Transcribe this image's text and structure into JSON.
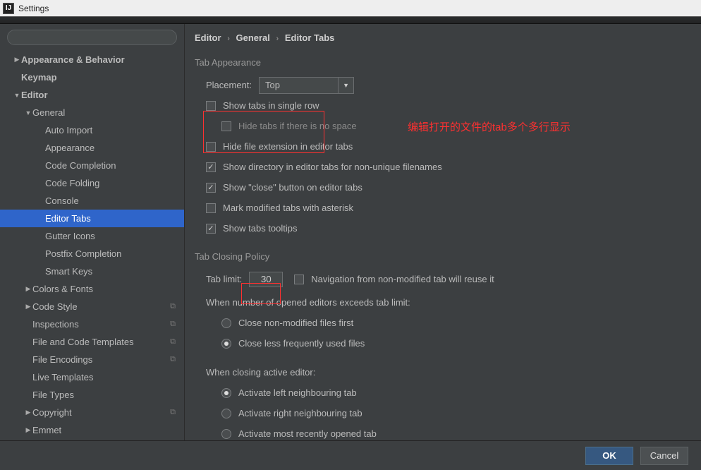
{
  "window": {
    "title": "Settings"
  },
  "sidebar": {
    "search_placeholder": "",
    "items": [
      {
        "label": "Appearance & Behavior",
        "depth": 0,
        "arrow": "right",
        "bold": true
      },
      {
        "label": "Keymap",
        "depth": 0,
        "bold": true
      },
      {
        "label": "Editor",
        "depth": 0,
        "arrow": "down",
        "bold": true
      },
      {
        "label": "General",
        "depth": 1,
        "arrow": "down"
      },
      {
        "label": "Auto Import",
        "depth": 2
      },
      {
        "label": "Appearance",
        "depth": 2
      },
      {
        "label": "Code Completion",
        "depth": 2
      },
      {
        "label": "Code Folding",
        "depth": 2
      },
      {
        "label": "Console",
        "depth": 2
      },
      {
        "label": "Editor Tabs",
        "depth": 2,
        "selected": true
      },
      {
        "label": "Gutter Icons",
        "depth": 2
      },
      {
        "label": "Postfix Completion",
        "depth": 2
      },
      {
        "label": "Smart Keys",
        "depth": 2
      },
      {
        "label": "Colors & Fonts",
        "depth": 1,
        "arrow": "right"
      },
      {
        "label": "Code Style",
        "depth": 1,
        "arrow": "right",
        "badge": true
      },
      {
        "label": "Inspections",
        "depth": 1,
        "badge": true
      },
      {
        "label": "File and Code Templates",
        "depth": 1,
        "badge": true
      },
      {
        "label": "File Encodings",
        "depth": 1,
        "badge": true
      },
      {
        "label": "Live Templates",
        "depth": 1
      },
      {
        "label": "File Types",
        "depth": 1
      },
      {
        "label": "Copyright",
        "depth": 1,
        "arrow": "right",
        "badge": true
      },
      {
        "label": "Emmet",
        "depth": 1,
        "arrow": "right"
      }
    ]
  },
  "breadcrumb": {
    "a": "Editor",
    "b": "General",
    "c": "Editor Tabs"
  },
  "tabAppearance": {
    "title": "Tab Appearance",
    "placement_label": "Placement:",
    "placement_value": "Top",
    "c1": "Show tabs in single row",
    "c1b": "Hide tabs if there is no space",
    "c2": "Hide file extension in editor tabs",
    "c3": "Show directory in editor tabs for non-unique filenames",
    "c4": "Show \"close\" button on editor tabs",
    "c5": "Mark modified tabs with asterisk",
    "c6": "Show tabs tooltips"
  },
  "tabClosing": {
    "title": "Tab Closing Policy",
    "limit_label": "Tab limit:",
    "limit_value": "30",
    "nav_reuse": "Navigation from non-modified tab will reuse it",
    "exceed_label": "When number of opened editors exceeds tab limit:",
    "r1": "Close non-modified files first",
    "r2": "Close less frequently used files",
    "close_active_label": "When closing active editor:",
    "ra": "Activate left neighbouring tab",
    "rb": "Activate right neighbouring tab",
    "rc": "Activate most recently opened tab"
  },
  "annotation": {
    "text": "编辑打开的文件的tab多个多行显示"
  },
  "footer": {
    "ok": "OK",
    "cancel": "Cancel"
  }
}
